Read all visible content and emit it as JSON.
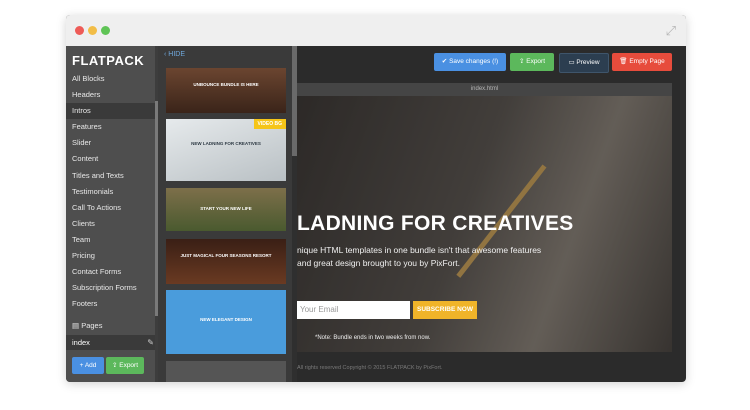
{
  "app": {
    "brand": "FLATPACK"
  },
  "sidebar": {
    "items": [
      {
        "label": "All Blocks"
      },
      {
        "label": "Headers"
      },
      {
        "label": "Intros"
      },
      {
        "label": "Features"
      },
      {
        "label": "Slider"
      },
      {
        "label": "Content"
      },
      {
        "label": "Titles and Texts"
      },
      {
        "label": "Testimonials"
      },
      {
        "label": "Call To Actions"
      },
      {
        "label": "Clients"
      },
      {
        "label": "Team"
      },
      {
        "label": "Pricing"
      },
      {
        "label": "Contact Forms"
      },
      {
        "label": "Subscription Forms"
      },
      {
        "label": "Footers"
      }
    ],
    "active_item": "Intros",
    "pages_label": "Pages",
    "page_name": "index",
    "add_label": "Add",
    "export_label": "Export"
  },
  "panel": {
    "hide_label": "HIDE",
    "thumbs": [
      {
        "caption": "UNBOUNCE BUNDLE IS HERE"
      },
      {
        "caption": "NEW LADNING FOR CREATIVES",
        "badge": "VIDEO BG"
      },
      {
        "caption": "START YOUR NEW LIFE"
      },
      {
        "caption": "JUST MAGICAL FOUR SEASONS RESORT"
      },
      {
        "caption": "NEW ELEGANT DESIGN"
      }
    ]
  },
  "toolbar": {
    "save_label": "Save changes (!)",
    "export_label": "Export",
    "preview_label": "Preview",
    "empty_label": "Empty Page"
  },
  "canvas": {
    "tab_label": "index.html",
    "hero_title": "LADNING FOR CREATIVES",
    "hero_text": "nique HTML templates in one bundle isn't that awesome features and great design brought to you by PixFort.",
    "email_placeholder": "Your Email",
    "subscribe_label": "SUBSCRIBE NOW",
    "note": "*Note: Bundle ends in two weeks from now.",
    "footer": "All rights reserved Copyright © 2015 FLATPACK by PixFort."
  },
  "colors": {
    "save": "#4a90e2",
    "export": "#5cb85c",
    "preview": "#2c3e50",
    "empty": "#e74c3c",
    "subscribe": "#f0b429"
  }
}
